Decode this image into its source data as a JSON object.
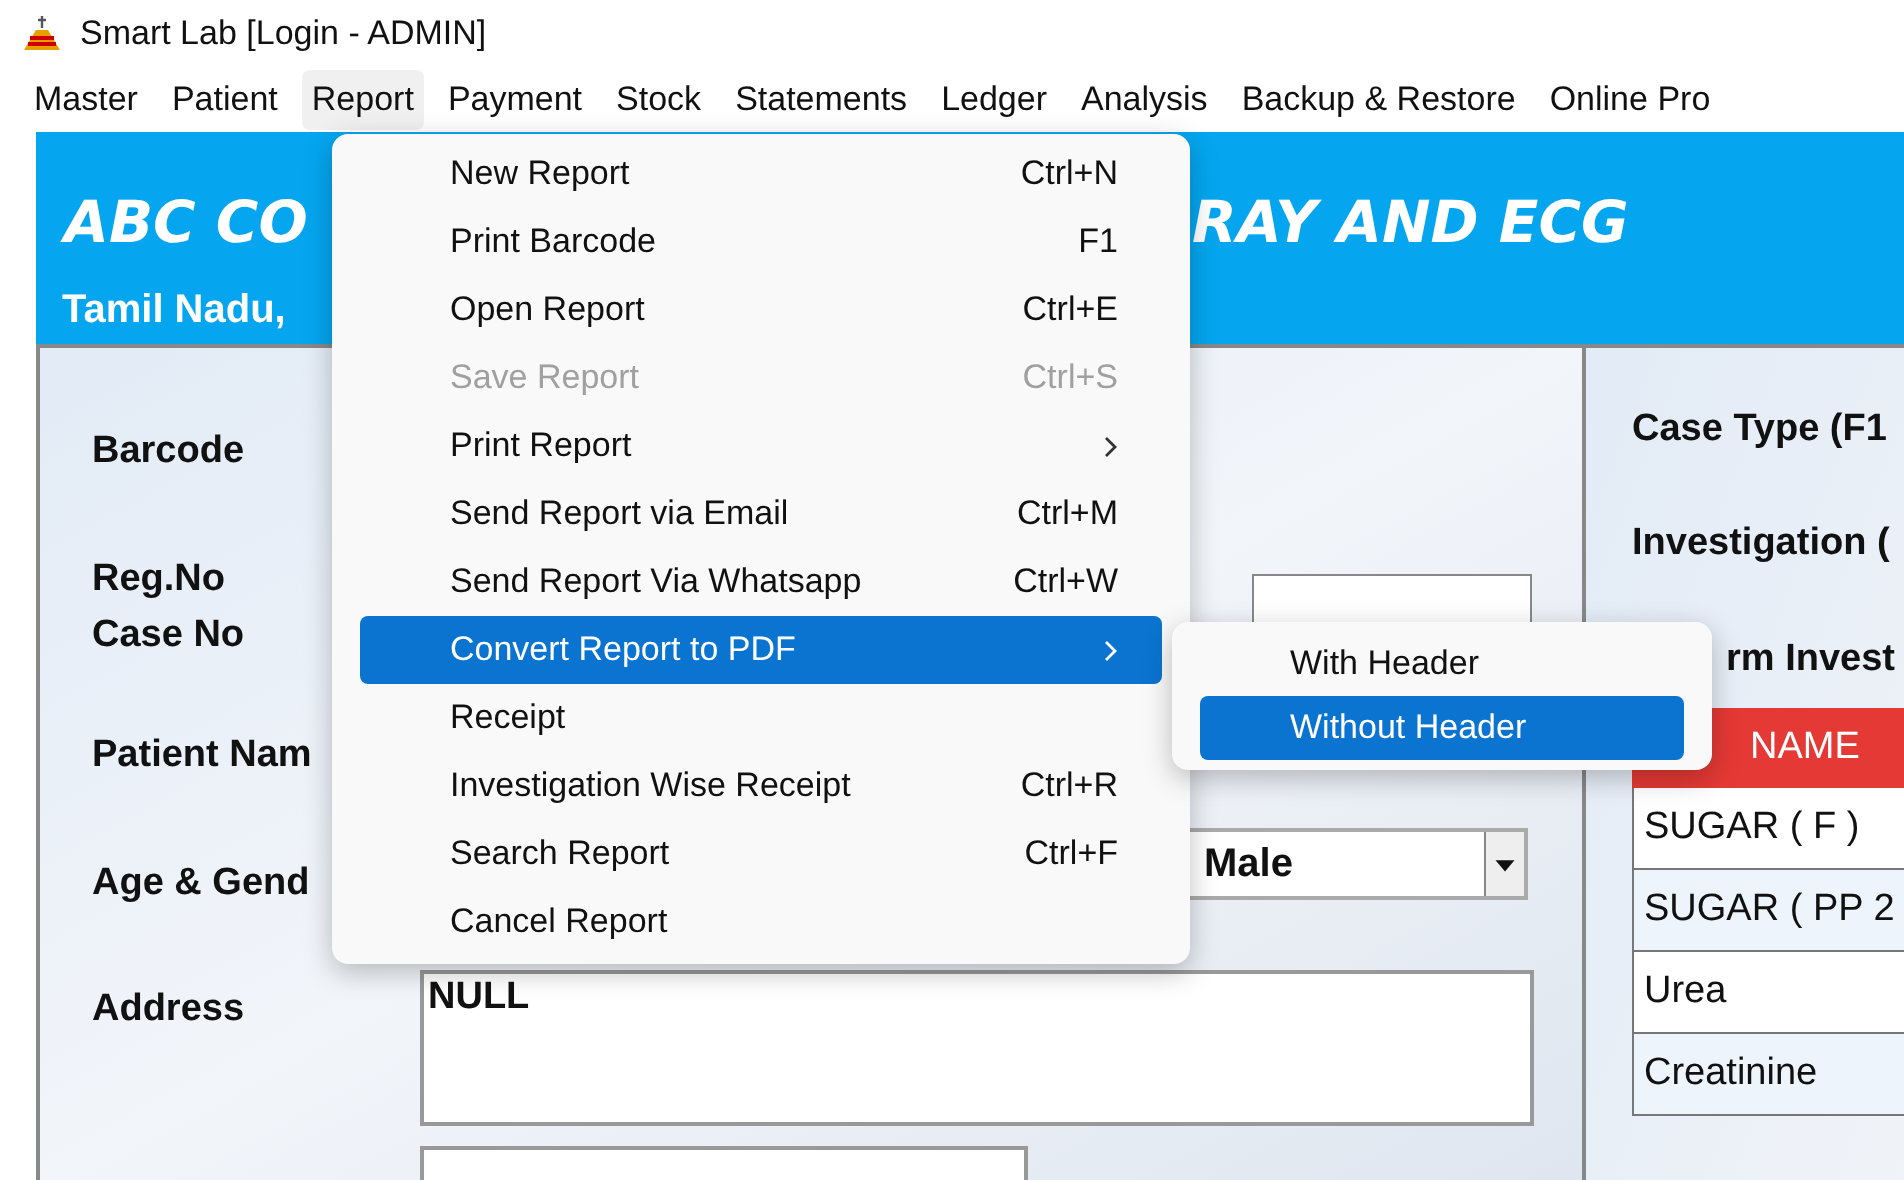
{
  "window": {
    "title": "Smart Lab [Login -  ADMIN]"
  },
  "menu_bar": [
    {
      "label": "Master",
      "selected": false
    },
    {
      "label": "Patient",
      "selected": false
    },
    {
      "label": "Report",
      "selected": true
    },
    {
      "label": "Payment",
      "selected": false
    },
    {
      "label": "Stock",
      "selected": false
    },
    {
      "label": "Statements",
      "selected": false
    },
    {
      "label": "Ledger",
      "selected": false
    },
    {
      "label": "Analysis",
      "selected": false
    },
    {
      "label": "Backup & Restore",
      "selected": false
    },
    {
      "label": "Online Pro",
      "selected": false
    }
  ],
  "header": {
    "title_left": "ABC CO",
    "title_right": "RAY AND ECG",
    "subtitle": "Tamil Nadu,"
  },
  "form": {
    "labels": [
      "Barcode",
      "Reg.No",
      "Case No",
      "Patient Nam",
      "Age & Gend",
      "Address"
    ],
    "gender": "Male",
    "address": "NULL"
  },
  "right_panel": {
    "case_type": "Case Type  (F1",
    "investigation": "Investigation (",
    "form_invest": "rm Invest",
    "table_header": "NAME",
    "rows": [
      "SUGAR ( F )",
      "SUGAR ( PP 2",
      "Urea",
      "Creatinine"
    ]
  },
  "report_menu": [
    {
      "label": "New Report",
      "shortcut": "Ctrl+N",
      "disabled": false,
      "selected": false,
      "submenu": false
    },
    {
      "label": "Print Barcode",
      "shortcut": "F1",
      "disabled": false,
      "selected": false,
      "submenu": false
    },
    {
      "label": "Open Report",
      "shortcut": "Ctrl+E",
      "disabled": false,
      "selected": false,
      "submenu": false
    },
    {
      "label": "Save Report",
      "shortcut": "Ctrl+S",
      "disabled": true,
      "selected": false,
      "submenu": false
    },
    {
      "label": "Print Report",
      "disabled": false,
      "selected": false,
      "submenu": true
    },
    {
      "label": "Send Report via Email",
      "shortcut": "Ctrl+M",
      "disabled": false,
      "selected": false,
      "submenu": false
    },
    {
      "label": "Send Report Via Whatsapp",
      "shortcut": "Ctrl+W",
      "disabled": false,
      "selected": false,
      "submenu": false
    },
    {
      "label": "Convert Report to PDF",
      "disabled": false,
      "selected": true,
      "submenu": true
    },
    {
      "label": "Receipt",
      "disabled": false,
      "selected": false,
      "submenu": false
    },
    {
      "label": "Investigation Wise Receipt",
      "shortcut": "Ctrl+R",
      "disabled": false,
      "selected": false,
      "submenu": false
    },
    {
      "label": "Search Report",
      "shortcut": "Ctrl+F",
      "disabled": false,
      "selected": false,
      "submenu": false
    },
    {
      "label": "Cancel Report",
      "disabled": false,
      "selected": false,
      "submenu": false
    }
  ],
  "pdf_submenu": [
    {
      "label": "With Header",
      "selected": false
    },
    {
      "label": "Without Header",
      "selected": true
    }
  ]
}
